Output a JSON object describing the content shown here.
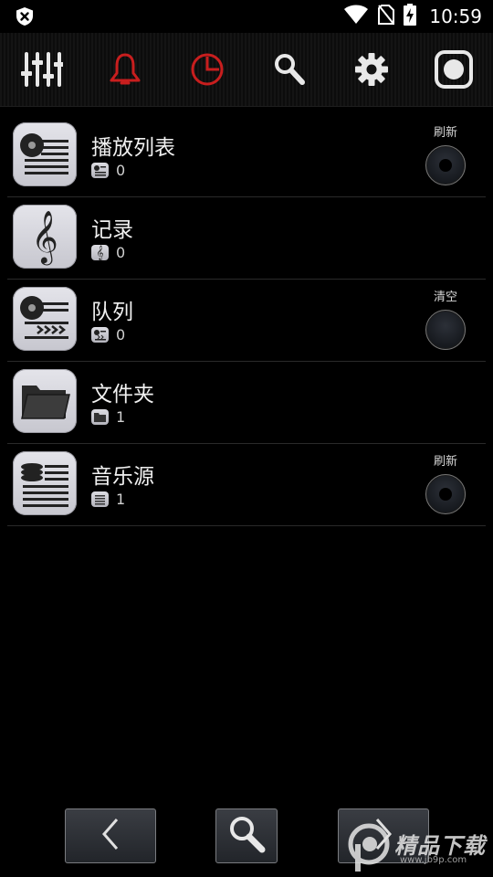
{
  "status_bar": {
    "time": "10:59",
    "icons": [
      "shield-x-icon",
      "wifi-icon",
      "no-sim-icon",
      "battery-charging-icon"
    ]
  },
  "toolbar": {
    "buttons": [
      "equalizer-icon",
      "alarm-bell-icon",
      "sleep-timer-icon",
      "search-icon",
      "settings-gear-icon",
      "stop-record-icon"
    ],
    "accent_color": "#d02020"
  },
  "library": {
    "items": [
      {
        "label": "播放列表",
        "count": "0",
        "icon": "playlist-icon",
        "action": "刷新",
        "action_style": "refresh"
      },
      {
        "label": "记录",
        "count": "0",
        "icon": "treble-clef-icon"
      },
      {
        "label": "队列",
        "count": "0",
        "icon": "queue-icon",
        "action": "清空",
        "action_style": "clear"
      },
      {
        "label": "文件夹",
        "count": "1",
        "icon": "folder-icon"
      },
      {
        "label": "音乐源",
        "count": "1",
        "icon": "music-source-icon",
        "action": "刷新",
        "action_style": "refresh"
      }
    ]
  },
  "bottom_nav": {
    "buttons": [
      "back-arrow-icon",
      "search-icon",
      "forward-arrow-icon"
    ]
  },
  "watermark": {
    "text": "精品下载",
    "url": "www.jb9p.com"
  }
}
